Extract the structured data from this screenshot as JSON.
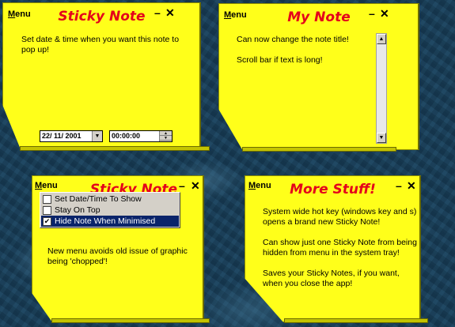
{
  "notes": [
    {
      "menu_label": "Menu",
      "title": "Sticky Note",
      "minimize": "–",
      "close": "✕",
      "lines": [
        "Set date & time when you want this note to pop up!"
      ],
      "date_value": "22/ 11/ 2001",
      "time_value": "00:00:00"
    },
    {
      "menu_label": "Menu",
      "title": "My Note",
      "minimize": "–",
      "close": "✕",
      "lines": [
        "Can now change the note title!",
        "Scroll bar if text is long!"
      ]
    },
    {
      "menu_label": "Menu",
      "title": "Sticky Note",
      "minimize": "–",
      "close": "✕",
      "lines": [
        "New menu avoids old issue of graphic being 'chopped'!"
      ],
      "popup_items": [
        {
          "label": "Set Date/Time To Show",
          "checked": false
        },
        {
          "label": "Stay On Top",
          "checked": false
        },
        {
          "label": "Hide Note When Minimised",
          "checked": true
        }
      ]
    },
    {
      "menu_label": "Menu",
      "title": "More Stuff!",
      "minimize": "–",
      "close": "✕",
      "lines": [
        "System wide hot key (windows key and s) opens a brand new Sticky Note!",
        "Can show just one Sticky Note from being hidden from menu in the system tray!",
        "Saves your Sticky Notes, if you want, when you close the app!"
      ]
    }
  ],
  "icons": {
    "dropdown": "▼",
    "scroll_up": "▲",
    "scroll_down": "▼",
    "check": "✔"
  },
  "colors": {
    "note_yellow": "#ffff1a",
    "title_red": "#e4001b",
    "desktop_blue": "#1e4660",
    "menu_highlight": "#0a246a"
  }
}
